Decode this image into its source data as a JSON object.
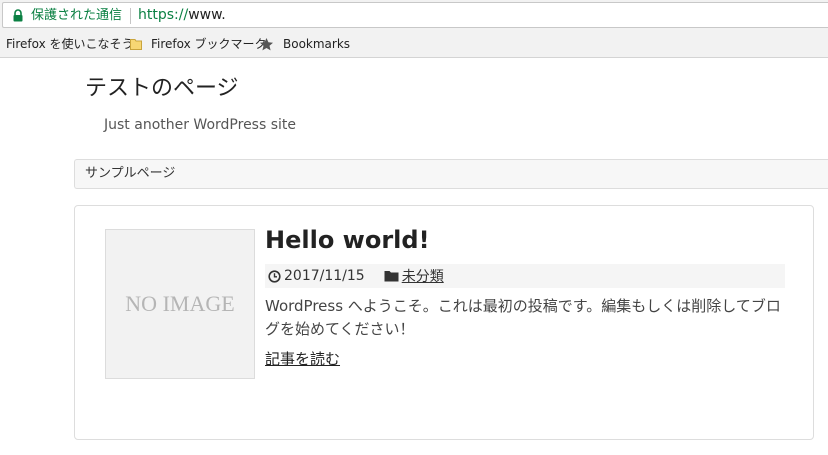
{
  "browser": {
    "secure_label": "保護された通信",
    "url_scheme": "https://",
    "url_host": "www.",
    "bookmarks": [
      {
        "label": "Firefox を使いこなそう",
        "icon": "none"
      },
      {
        "label": "Firefox ブックマーク",
        "icon": "folder-icon"
      },
      {
        "label": "Bookmarks",
        "icon": "star-icon"
      }
    ],
    "colors": {
      "secure": "#0b8043"
    }
  },
  "site": {
    "title": "テストのページ",
    "description": "Just another WordPress site"
  },
  "nav": {
    "items": [
      {
        "label": "サンプルページ"
      }
    ]
  },
  "post": {
    "thumbnail_text": "NO IMAGE",
    "title": "Hello world!",
    "date": "2017/11/15",
    "category": "未分類",
    "excerpt": "WordPress へようこそ。これは最初の投稿です。編集もしくは削除してブログを始めてください！",
    "read_more": "記事を読む"
  }
}
